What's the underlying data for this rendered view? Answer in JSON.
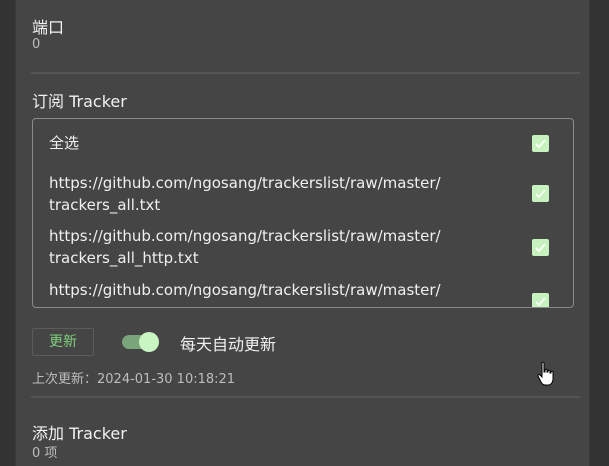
{
  "port": {
    "title": "端口",
    "value": "0"
  },
  "subscribe": {
    "title": "订阅 Tracker",
    "select_all": "全选",
    "items": [
      {
        "line1": "https://github.com/ngosang/trackerslist/raw/master/",
        "line2": "trackers_all.txt"
      },
      {
        "line1": "https://github.com/ngosang/trackerslist/raw/master/",
        "line2": "trackers_all_http.txt"
      },
      {
        "line1": "https://github.com/ngosang/trackerslist/raw/master/",
        "line2": ""
      }
    ],
    "update_button": "更新",
    "auto_update_label": "每天自动更新",
    "auto_update_enabled": true,
    "last_update": "上次更新：2024-01-30 10:18:21"
  },
  "add_tracker": {
    "title": "添加 Tracker",
    "count": "0 项"
  },
  "colors": {
    "accent_green": "#7fcf7f",
    "checkbox_fill": "#c7f2c0",
    "panel_bg": "#454545"
  }
}
